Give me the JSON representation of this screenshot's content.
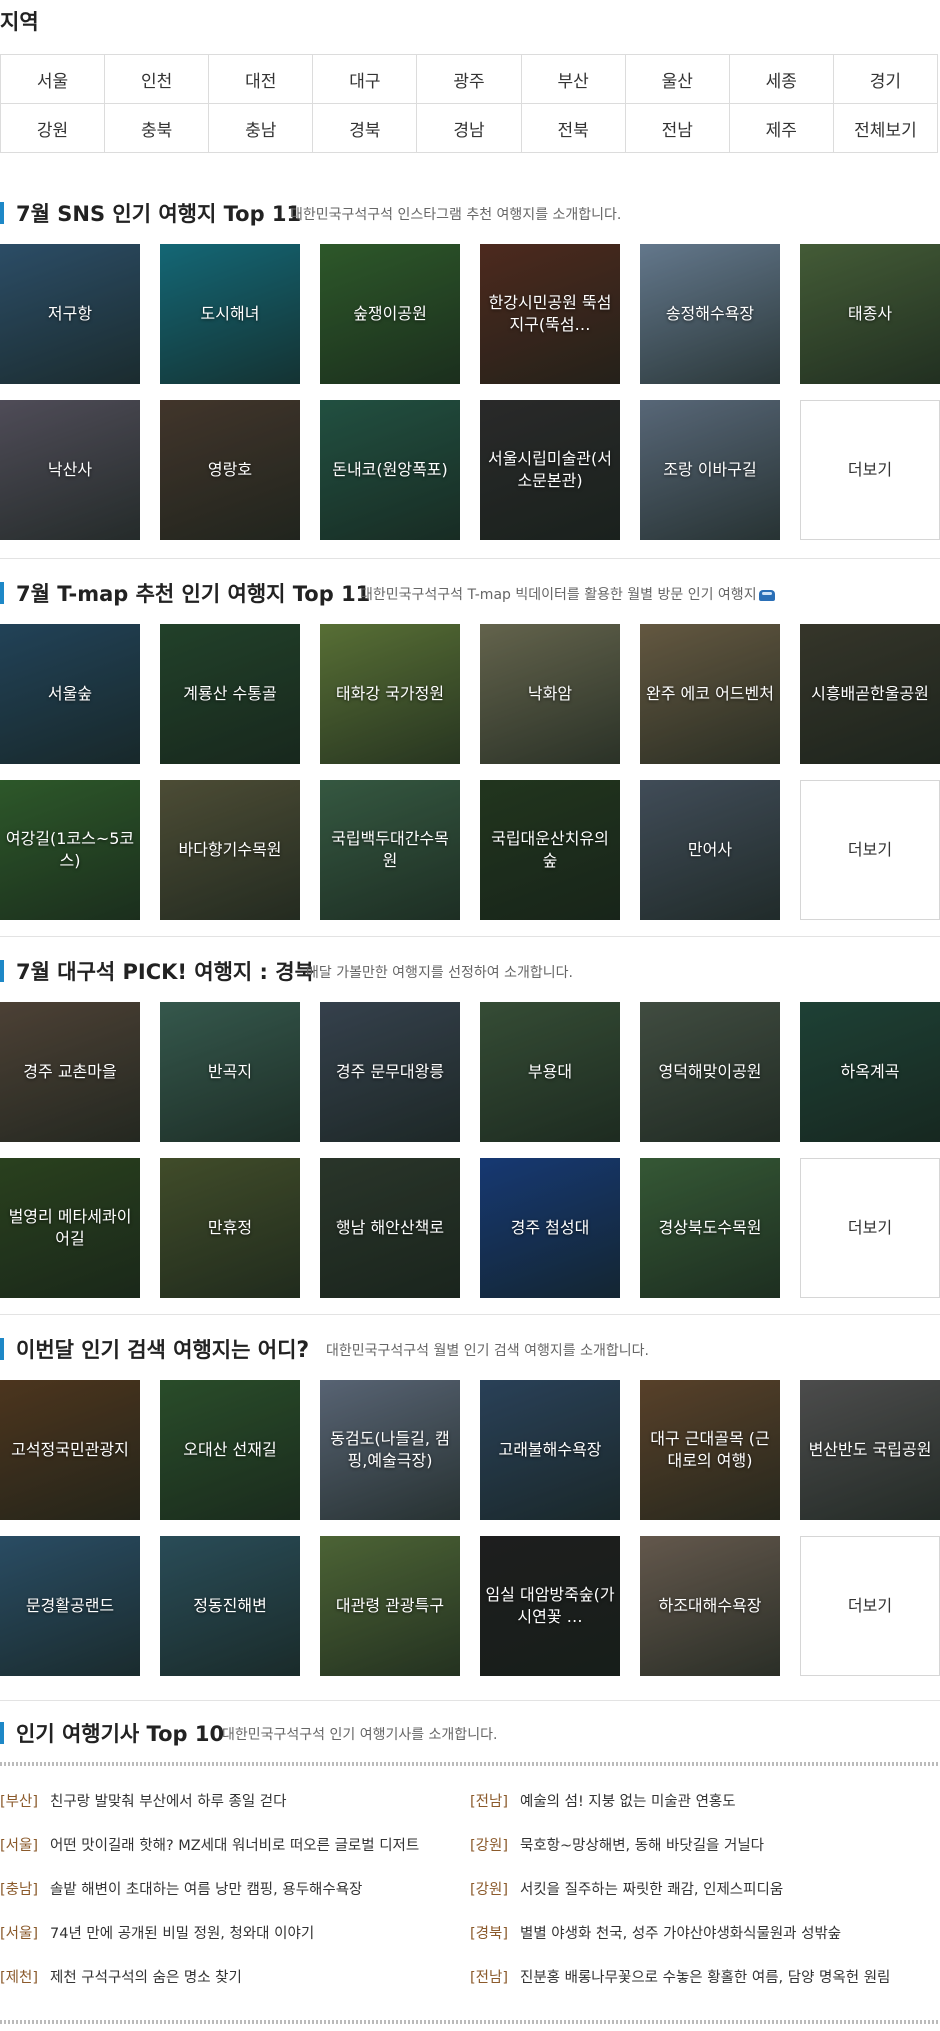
{
  "region": {
    "title": "지역",
    "rows": [
      [
        "서울",
        "인천",
        "대전",
        "대구",
        "광주",
        "부산",
        "울산",
        "세종",
        "경기"
      ],
      [
        "강원",
        "충북",
        "충남",
        "경북",
        "경남",
        "전북",
        "전남",
        "제주",
        "전체보기"
      ]
    ]
  },
  "sections": [
    {
      "title": "7월 SNS 인기 여행지 Top 11",
      "desc": "대한민국구석구석 인스타그램 추천 여행지를 소개합니다.",
      "icon": "",
      "tiles": [
        "저구항",
        "도시해녀",
        "숲쟁이공원",
        "한강시민공원 뚝섬지구(뚝섬…",
        "송정해수욕장",
        "태종사",
        "낙산사",
        "영랑호",
        "돈내코(원앙폭포)",
        "서울시립미술관(서소문본관)",
        "조랑 이바구길",
        "더보기"
      ]
    },
    {
      "title": "7월 T-map 추천 인기 여행지 Top 11",
      "desc": "대한민국구석구석 T-map 빅데이터를 활용한 월별 방문 인기 여행지",
      "icon": "car-icon",
      "tiles": [
        "서울숲",
        "계룡산 수통골",
        "태화강 국가정원",
        "낙화암",
        "완주 에코 어드벤처",
        "시흥배곧한울공원",
        "여강길(1코스~5코스)",
        "바다향기수목원",
        "국립백두대간수목원",
        "국립대운산치유의숲",
        "만어사",
        "더보기"
      ]
    },
    {
      "title": "7월 대구석 PICK! 여행지 : 경북",
      "desc": "매달 가볼만한 여행지를 선정하여 소개합니다.",
      "icon": "",
      "tiles": [
        "경주 교촌마을",
        "반곡지",
        "경주 문무대왕릉",
        "부용대",
        "영덕해맞이공원",
        "하옥계곡",
        "벌영리 메타세콰이어길",
        "만휴정",
        "행남 해안산책로",
        "경주 첨성대",
        "경상북도수목원",
        "더보기"
      ]
    },
    {
      "title": "이번달 인기 검색 여행지는 어디",
      "desc": "대한민국구석구석 월별 인기 검색 여행지를 소개합니다.",
      "icon": "question-icon",
      "tiles": [
        "고석정국민관광지",
        "오대산 선재길",
        "동검도(나들길, 캠핑,예술극장)",
        "고래불해수욕장",
        "대구 근대골목 (근대로의 여행)",
        "변산반도 국립공원",
        "문경활공랜드",
        "정동진해변",
        "대관령 관광특구",
        "임실 대암방죽숲(가시연꽃 …",
        "하조대해수욕장",
        "더보기"
      ]
    }
  ],
  "news": {
    "title": "인기 여행기사 Top 10",
    "desc": "대한민국구석구석 인기 여행기사를 소개합니다.",
    "left": [
      {
        "cat": "[부산]",
        "text": "친구랑 발맞춰 부산에서 하루 종일 걷다"
      },
      {
        "cat": "[서울]",
        "text": "어떤 맛이길래 핫해? MZ세대 워너비로 떠오른 글로벌 디저트"
      },
      {
        "cat": "[충남]",
        "text": "솔밭 해변이 초대하는 여름 낭만 캠핑, 용두해수욕장"
      },
      {
        "cat": "[서울]",
        "text": "74년 만에 공개된 비밀 정원, 청와대 이야기"
      },
      {
        "cat": "[제천]",
        "text": "제천 구석구석의 숨은 명소 찾기"
      }
    ],
    "right": [
      {
        "cat": "[전남]",
        "text": "예술의 섬! 지붕 없는 미술관 연홍도"
      },
      {
        "cat": "[강원]",
        "text": "묵호항~망상해변, 동해 바닷길을 거닐다"
      },
      {
        "cat": "[강원]",
        "text": "서킷을 질주하는 짜릿한 쾌감, 인제스피디움"
      },
      {
        "cat": "[경북]",
        "text": "별별 야생화 천국, 성주 가야산야생화식물원과 성밖숲"
      },
      {
        "cat": "[전남]",
        "text": "진분홍 배롱나무꽃으로 수놓은 황홀한 여름, 담양 명옥헌 원림"
      }
    ]
  }
}
